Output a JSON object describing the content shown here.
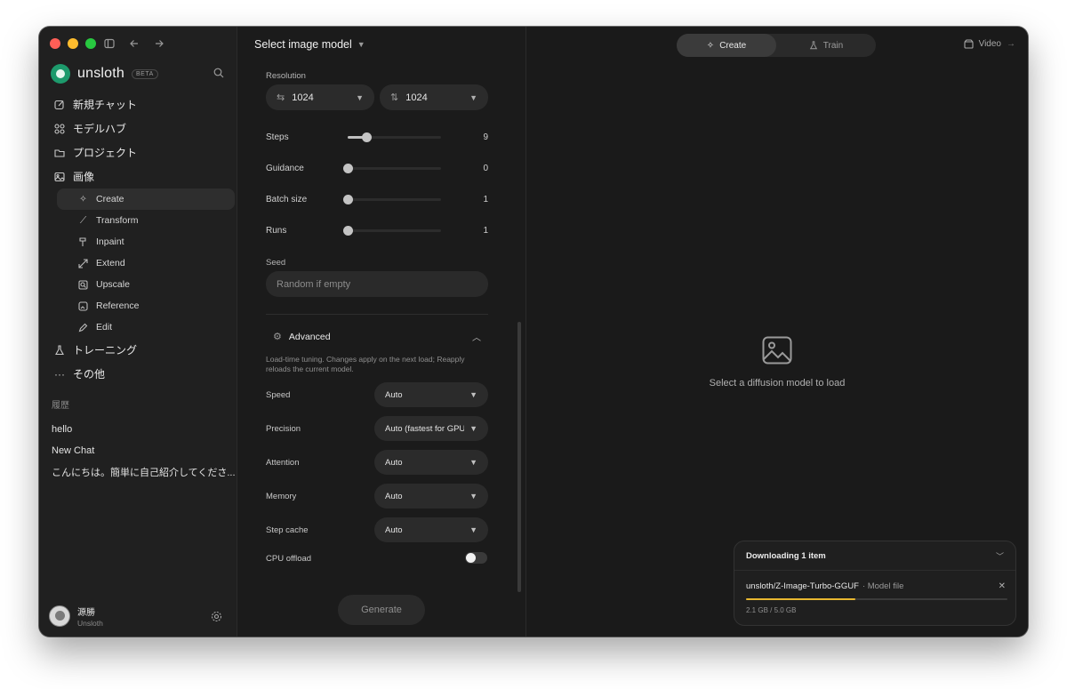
{
  "sidebar": {
    "brand": "unsloth",
    "beta": "BETA",
    "nav": [
      {
        "label": "新規チャット",
        "icon": "edit-icon"
      },
      {
        "label": "モデルハブ",
        "icon": "grid-icon"
      },
      {
        "label": "プロジェクト",
        "icon": "folder-icon"
      },
      {
        "label": "画像",
        "icon": "image-icon"
      }
    ],
    "image_sub": [
      {
        "label": "Create",
        "icon": "sparkle-icon",
        "active": true
      },
      {
        "label": "Transform",
        "icon": "magic-wand-icon"
      },
      {
        "label": "Inpaint",
        "icon": "brush-icon"
      },
      {
        "label": "Extend",
        "icon": "expand-icon"
      },
      {
        "label": "Upscale",
        "icon": "zoom-icon"
      },
      {
        "label": "Reference",
        "icon": "reference-icon"
      },
      {
        "label": "Edit",
        "icon": "pencil-icon"
      }
    ],
    "nav_bottom": [
      {
        "label": "トレーニング",
        "icon": "flask-icon"
      },
      {
        "label": "その他",
        "icon": "more-icon"
      }
    ],
    "history_title": "履歴",
    "history": [
      "hello",
      "New Chat",
      "こんにちは。簡単に自己紹介してくださ..."
    ],
    "user": {
      "name": "源勝",
      "org": "Unsloth"
    }
  },
  "panel": {
    "model_select": "Select image model",
    "resolution_label": "Resolution",
    "width": "1024",
    "height": "1024",
    "sliders": [
      {
        "name": "Steps",
        "value": "9",
        "fraction": 0.2
      },
      {
        "name": "Guidance",
        "value": "0",
        "fraction": 0
      },
      {
        "name": "Batch size",
        "value": "1",
        "fraction": 0
      },
      {
        "name": "Runs",
        "value": "1",
        "fraction": 0
      }
    ],
    "seed_label": "Seed",
    "seed_placeholder": "Random if empty",
    "advanced_title": "Advanced",
    "advanced_desc": "Load-time tuning. Changes apply on the next load; Reapply reloads the current model.",
    "options": [
      {
        "name": "Speed",
        "value": "Auto"
      },
      {
        "name": "Precision",
        "value": "Auto (fastest for GPU)"
      },
      {
        "name": "Attention",
        "value": "Auto"
      },
      {
        "name": "Memory",
        "value": "Auto"
      },
      {
        "name": "Step cache",
        "value": "Auto"
      }
    ],
    "cpu_offload_label": "CPU offload",
    "cpu_offload": false,
    "generate_label": "Generate"
  },
  "canvas": {
    "tabs": [
      {
        "label": "Create",
        "active": true
      },
      {
        "label": "Train",
        "active": false
      }
    ],
    "video_label": "Video",
    "empty_text": "Select a diffusion model to load",
    "download": {
      "title": "Downloading 1 item",
      "name": "unsloth/Z-Image-Turbo-GGUF",
      "kind": "· Model file",
      "size_text": "2.1 GB / 5.0 GB",
      "progress": 0.42
    }
  },
  "colors": {
    "accent_progress": "#e8b830",
    "logo": "#1d9a6c"
  }
}
